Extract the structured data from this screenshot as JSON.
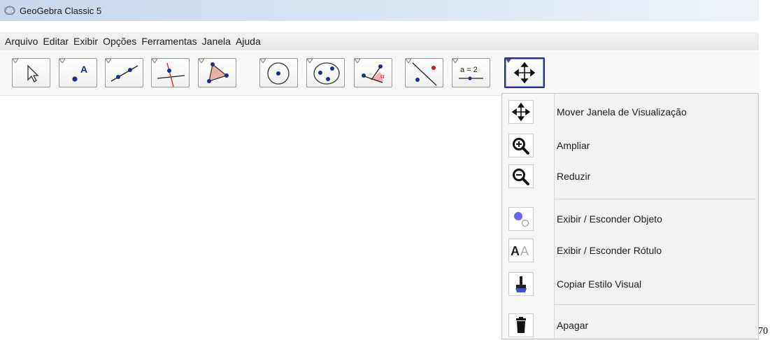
{
  "window": {
    "title": "GeoGebra Classic 5"
  },
  "menubar": {
    "items": [
      "Arquivo",
      "Editar",
      "Exibir",
      "Opções",
      "Ferramentas",
      "Janela",
      "Ajuda"
    ]
  },
  "toolbar": {
    "tools": [
      {
        "name": "move-tool",
        "icon": "arrow-pointer-icon"
      },
      {
        "name": "point-tool",
        "icon": "point-a-icon",
        "label": "A"
      },
      {
        "name": "line-tool",
        "icon": "line-through-points-icon"
      },
      {
        "name": "perpendicular-line-tool",
        "icon": "perpendicular-line-icon"
      },
      {
        "name": "polygon-tool",
        "icon": "polygon-icon"
      },
      {
        "name": "circle-tool",
        "icon": "circle-center-point-icon"
      },
      {
        "name": "conic-tool",
        "icon": "ellipse-icon"
      },
      {
        "name": "angle-tool",
        "icon": "angle-icon",
        "label": "α"
      },
      {
        "name": "reflect-tool",
        "icon": "reflect-about-line-icon"
      },
      {
        "name": "slider-tool",
        "icon": "slider-icon",
        "label": "a = 2"
      },
      {
        "name": "move-graphics-view-tool",
        "icon": "four-arrows-icon",
        "active": true
      }
    ]
  },
  "dropdown": {
    "items": [
      {
        "label": "Mover Janela de Visualização",
        "icon": "four-arrows-icon"
      },
      {
        "label": "Ampliar",
        "icon": "zoom-in-icon"
      },
      {
        "label": "Reduzir",
        "icon": "zoom-out-icon"
      },
      {
        "label": "Exibir / Esconder Objeto",
        "icon": "show-hide-object-icon"
      },
      {
        "label": "Exibir / Esconder Rótulo",
        "icon": "show-hide-label-icon",
        "glyph": "AA"
      },
      {
        "label": "Copiar Estilo Visual",
        "icon": "paintbrush-icon"
      },
      {
        "label": "Apagar",
        "icon": "trash-icon"
      }
    ]
  },
  "page_number": "70",
  "colors": {
    "accent": "#2a2f8f",
    "point": "#1c2c8c",
    "highlight": "#e05050"
  }
}
